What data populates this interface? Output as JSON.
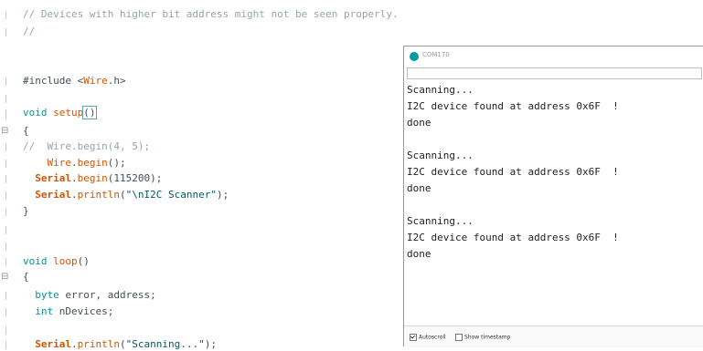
{
  "code_lines": [
    {
      "segs": [
        {
          "t": "// Devices with higher bit address might not be seen properly.",
          "c": "cm"
        }
      ]
    },
    {
      "segs": [
        {
          "t": "//",
          "c": "cm"
        }
      ]
    },
    {
      "segs": []
    },
    {
      "segs": [
        {
          "t": "#include <",
          "c": ""
        },
        {
          "t": "Wire",
          "c": "fn"
        },
        {
          "t": ".h>",
          "c": ""
        }
      ]
    },
    {
      "segs": []
    },
    {
      "segs": []
    },
    {
      "segs": [
        {
          "t": "void",
          "c": "kw"
        },
        {
          "t": " ",
          "c": ""
        },
        {
          "t": "setup",
          "c": "fn"
        },
        {
          "t": "()",
          "c": "br"
        }
      ]
    },
    {
      "segs": [
        {
          "t": "{",
          "c": ""
        }
      ]
    },
    {
      "segs": [
        {
          "t": "//  Wire.begin(4, 5);",
          "c": "cm"
        }
      ]
    },
    {
      "segs": [
        {
          "t": "    ",
          "c": ""
        },
        {
          "t": "Wire",
          "c": "fn"
        },
        {
          "t": ".",
          "c": ""
        },
        {
          "t": "begin",
          "c": "fn"
        },
        {
          "t": "();",
          "c": ""
        }
      ]
    },
    {
      "segs": [
        {
          "t": "  ",
          "c": ""
        },
        {
          "t": "Serial",
          "c": "cls"
        },
        {
          "t": ".",
          "c": ""
        },
        {
          "t": "begin",
          "c": "fn"
        },
        {
          "t": "(115200);",
          "c": ""
        }
      ]
    },
    {
      "segs": [
        {
          "t": "  ",
          "c": ""
        },
        {
          "t": "Serial",
          "c": "cls"
        },
        {
          "t": ".",
          "c": ""
        },
        {
          "t": "println",
          "c": "fn"
        },
        {
          "t": "(",
          "c": ""
        },
        {
          "t": "\"\\nI2C Scanner\"",
          "c": "str"
        },
        {
          "t": ");",
          "c": ""
        }
      ]
    },
    {
      "segs": [
        {
          "t": "}",
          "c": ""
        }
      ]
    },
    {
      "segs": []
    },
    {
      "segs": []
    },
    {
      "segs": [
        {
          "t": "void",
          "c": "kw"
        },
        {
          "t": " ",
          "c": ""
        },
        {
          "t": "loop",
          "c": "fn"
        },
        {
          "t": "()",
          "c": ""
        }
      ]
    },
    {
      "segs": [
        {
          "t": "{",
          "c": ""
        }
      ]
    },
    {
      "segs": [
        {
          "t": "  ",
          "c": ""
        },
        {
          "t": "byte",
          "c": "kw"
        },
        {
          "t": " error, address;",
          "c": ""
        }
      ]
    },
    {
      "segs": [
        {
          "t": "  ",
          "c": ""
        },
        {
          "t": "int",
          "c": "kw"
        },
        {
          "t": " nDevices;",
          "c": ""
        }
      ]
    },
    {
      "segs": []
    },
    {
      "segs": [
        {
          "t": "  ",
          "c": ""
        },
        {
          "t": "Serial",
          "c": "cls"
        },
        {
          "t": ".",
          "c": ""
        },
        {
          "t": "println",
          "c": "fn"
        },
        {
          "t": "(",
          "c": ""
        },
        {
          "t": "\"Scanning...\"",
          "c": "str"
        },
        {
          "t": ");",
          "c": ""
        }
      ]
    }
  ],
  "serial_monitor": {
    "title": "COM170",
    "output_lines": [
      "Scanning...",
      "I2C device found at address 0x6F  !",
      "done",
      "",
      "Scanning...",
      "I2C device found at address 0x6F  !",
      "done",
      "",
      "Scanning...",
      "I2C device found at address 0x6F  !",
      "done"
    ],
    "autoscroll_label": "Autoscroll",
    "autoscroll_checked": true,
    "timestamp_label": "Show timestamp",
    "timestamp_checked": false
  }
}
